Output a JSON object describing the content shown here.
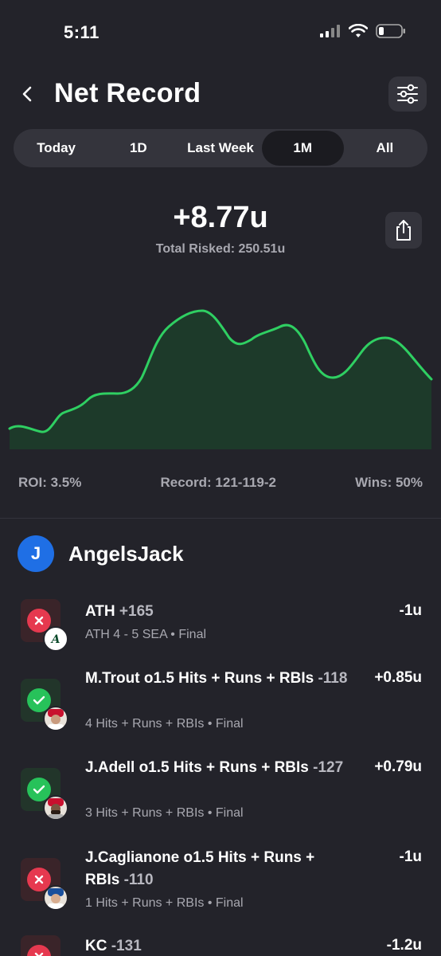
{
  "status_bar": {
    "time": "5:11"
  },
  "header": {
    "title": "Net Record"
  },
  "tabs": [
    {
      "label": "Today",
      "active": false
    },
    {
      "label": "1D",
      "active": false
    },
    {
      "label": "Last Week",
      "active": false
    },
    {
      "label": "1M",
      "active": true
    },
    {
      "label": "All",
      "active": false
    }
  ],
  "summary": {
    "total": "+8.77u",
    "risked": "Total Risked: 250.51u"
  },
  "stats": {
    "roi": "ROI: 3.5%",
    "record": "Record: 121-119-2",
    "wins": "Wins: 50%"
  },
  "user": {
    "initial": "J",
    "name": "AngelsJack"
  },
  "bets": [
    {
      "title": "ATH",
      "odds": "+165",
      "sub": "ATH 4 - 5 SEA • Final",
      "amount": "-1u",
      "result": "loss",
      "icon": "athletics-logo-icon"
    },
    {
      "title": "M.Trout o1.5 Hits + Runs + RBIs",
      "odds": "-118",
      "sub": "4 Hits + Runs + RBIs • Final",
      "amount": "+0.85u",
      "result": "win",
      "icon": "player-avatar-icon"
    },
    {
      "title": "J.Adell o1.5 Hits + Runs + RBIs",
      "odds": "-127",
      "sub": "3 Hits + Runs + RBIs • Final",
      "amount": "+0.79u",
      "result": "win",
      "icon": "player-avatar-icon"
    },
    {
      "title": "J.Caglianone o1.5 Hits + Runs + RBIs",
      "odds": "-110",
      "sub": "1 Hits + Runs + RBIs • Final",
      "amount": "-1u",
      "result": "loss",
      "icon": "player-avatar-icon"
    },
    {
      "title": "KC",
      "odds": "-131",
      "sub": "",
      "amount": "-1.2u",
      "result": "loss",
      "icon": "royals-logo-icon"
    }
  ],
  "colors": {
    "accent_green": "#27c25a",
    "loss_red": "#e6394f",
    "avatar_blue": "#1f6fe5"
  }
}
